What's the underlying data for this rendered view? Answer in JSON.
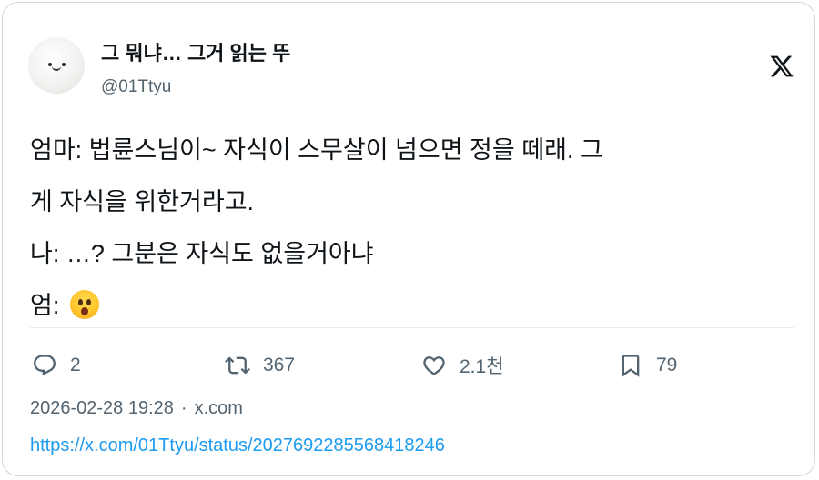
{
  "author": {
    "display_name": "그 뭐냐… 그거 읽는 뚜",
    "handle": "@01Ttyu",
    "avatar": "smiling-plush-avatar"
  },
  "logo": "x-logo-icon",
  "tweet": {
    "lines": [
      "엄마: 법륜스님이~ 자식이 스무살이 넘으면 정을 떼래. 그",
      "게 자식을 위한거라고.",
      "나: …? 그분은 자식도 없을거아냐",
      "엄: "
    ],
    "emoji": "astonished-face-emoji"
  },
  "actions": {
    "reply_count": "2",
    "retweet_count": "367",
    "like_count": "2.1천",
    "bookmark_count": "79"
  },
  "meta": {
    "timestamp": "2026-02-28 19:28",
    "separator": "·",
    "source": "x.com"
  },
  "url": "https://x.com/01Ttyu/status/2027692285568418246",
  "colors": {
    "text": "#0f1419",
    "secondary": "#536471",
    "link": "#1d9bf0",
    "border": "#cfd9de"
  }
}
